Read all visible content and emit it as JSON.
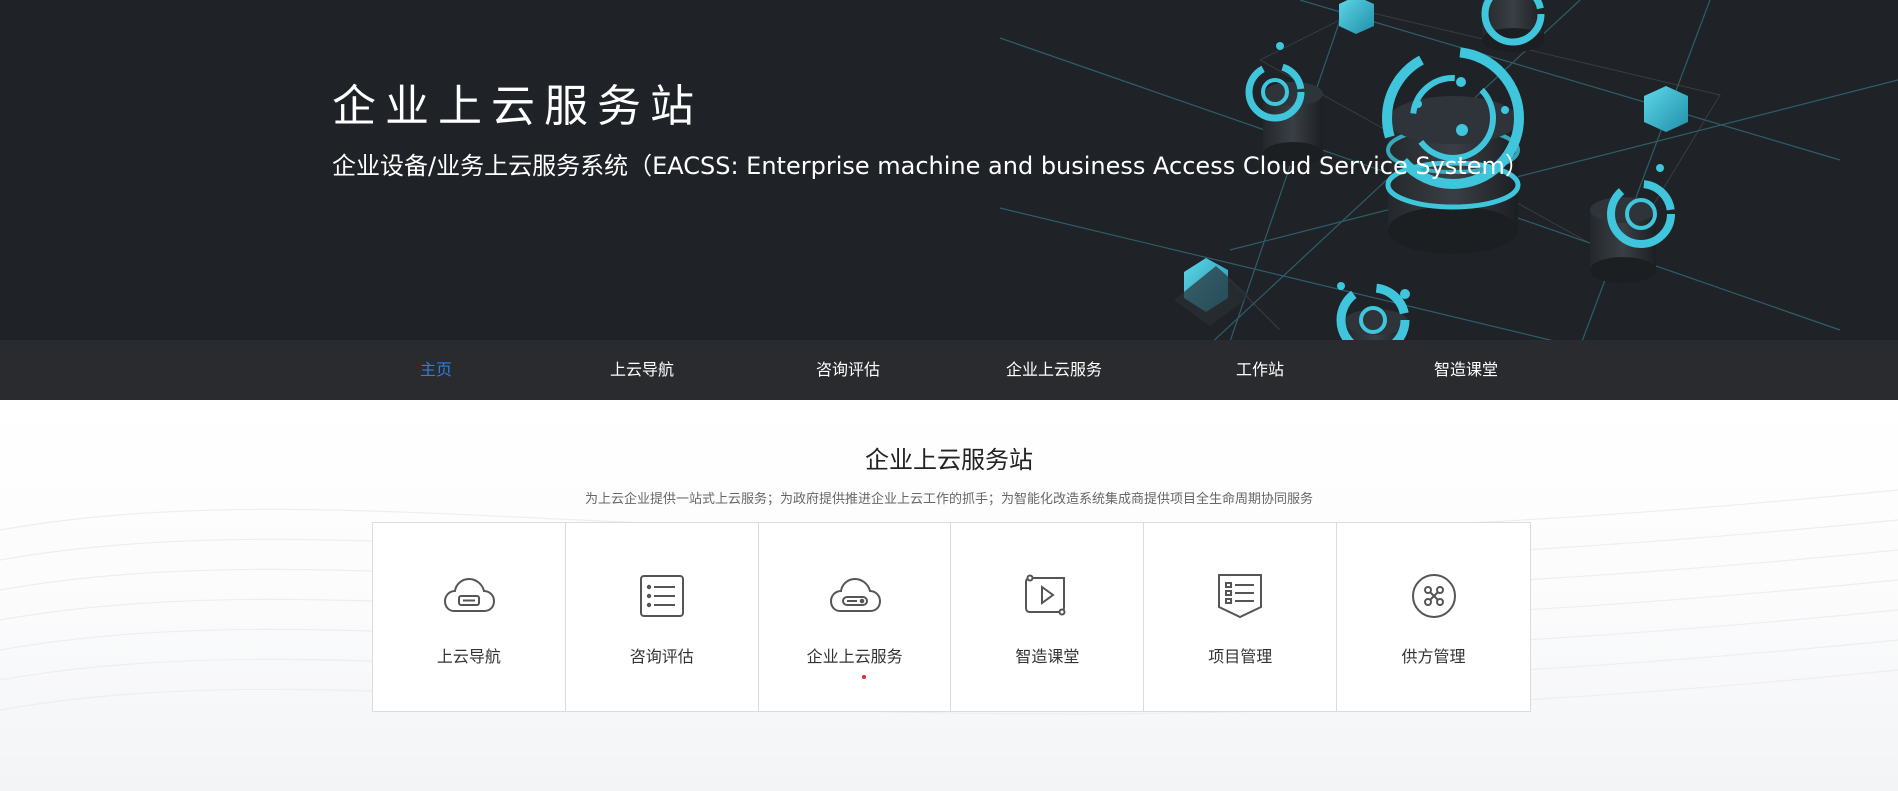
{
  "hero": {
    "title": "企业上云服务站",
    "subtitle": "企业设备/业务上云服务系统（EACSS: Enterprise machine and business Access Cloud Service System）"
  },
  "nav": {
    "items": [
      {
        "label": "主页",
        "active": true
      },
      {
        "label": "上云导航",
        "active": false
      },
      {
        "label": "咨询评估",
        "active": false
      },
      {
        "label": "企业上云服务",
        "active": false
      },
      {
        "label": "工作站",
        "active": false
      },
      {
        "label": "智造课堂",
        "active": false
      }
    ],
    "active_color": "#2f7de1"
  },
  "section": {
    "title": "企业上云服务站",
    "description": "为上云企业提供一站式上云服务；为政府提供推进企业上云工作的抓手；为智能化改造系统集成商提供项目全生命周期协同服务"
  },
  "services": [
    {
      "label": "上云导航",
      "icon": "cloud-icon"
    },
    {
      "label": "咨询评估",
      "icon": "list-icon"
    },
    {
      "label": "企业上云服务",
      "icon": "cloud-server-icon",
      "indicator_color": "#d62a2a"
    },
    {
      "label": "智造课堂",
      "icon": "video-icon"
    },
    {
      "label": "项目管理",
      "icon": "document-list-icon"
    },
    {
      "label": "供方管理",
      "icon": "network-icon"
    }
  ],
  "colors": {
    "hero_bg": "#1f2226",
    "accent_cyan": "#3fc6dc"
  }
}
